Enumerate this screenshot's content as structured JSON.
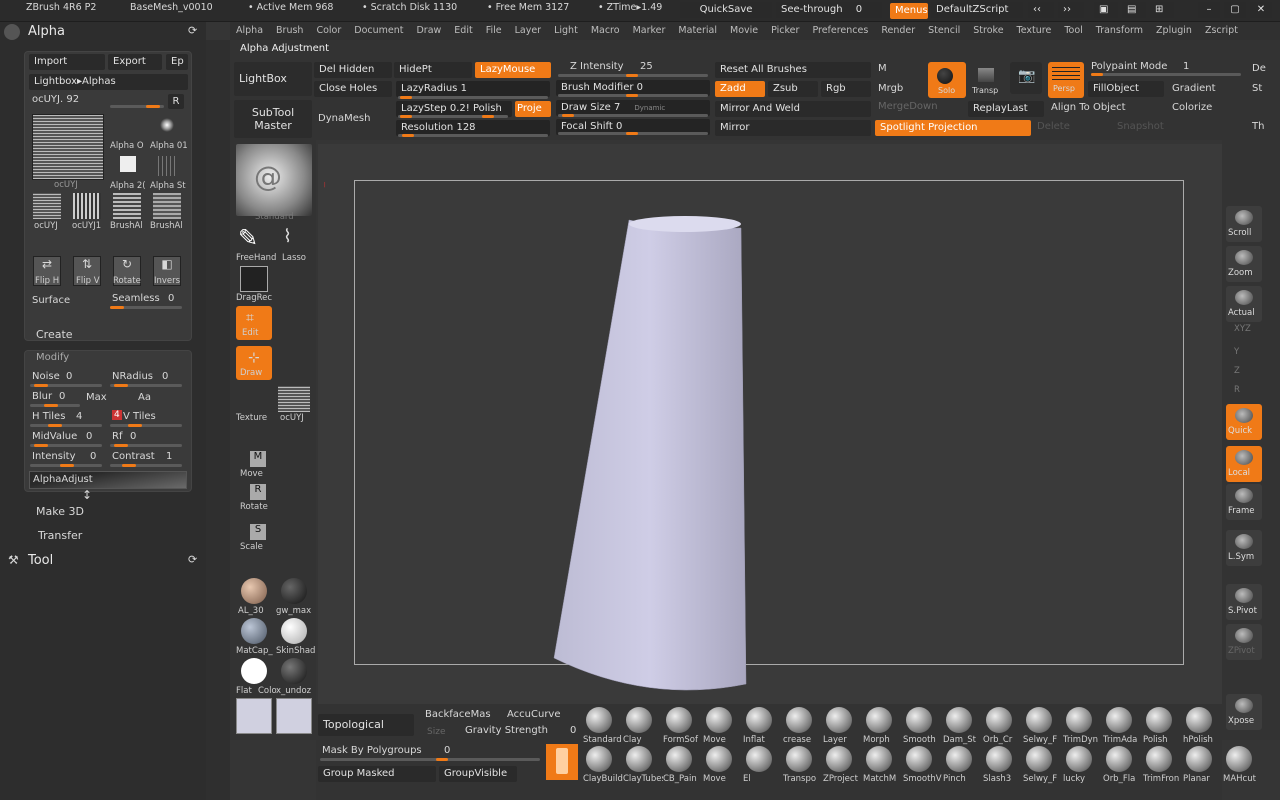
{
  "topbar": {
    "app": "ZBrush 4R6 P2",
    "mesh": "BaseMesh_v0010",
    "active": "• Active Mem 968",
    "scratch": "• Scratch Disk 1130",
    "free": "• Free Mem 3127",
    "ztime": "• ZTime▸1.49",
    "quicksave": "QuickSave",
    "seethrough": "See-through",
    "seethrough_val": "0",
    "menus": "Menus",
    "script": "DefaultZScript"
  },
  "menubar": [
    "Alpha",
    "Brush",
    "Color",
    "Document",
    "Draw",
    "Edit",
    "File",
    "Layer",
    "Light",
    "Macro",
    "Marker",
    "Material",
    "Movie",
    "Picker",
    "Preferences",
    "Render",
    "Stencil",
    "Stroke",
    "Texture",
    "Tool",
    "Transform",
    "Zplugin",
    "Zscript"
  ],
  "alpha_panel": {
    "title": "Alpha",
    "import": "Import",
    "export": "Export",
    "ep": "Ep",
    "lightbox": "Lightbox▸Alphas",
    "current": "ocUYJ. 92",
    "r": "R",
    "thumbs": [
      "Alpha O",
      "Alpha 01",
      "Alpha 2(",
      "Alpha St"
    ],
    "thumbs2": [
      "ocUYJ",
      "ocUYJ1",
      "BrushAl",
      "BrushAl"
    ],
    "flip_h": "Flip H",
    "flip_v": "Flip V",
    "rotate": "Rotate",
    "invers": "Invers",
    "surface": "Surface",
    "seamless": "Seamless",
    "seamless_val": "0",
    "create": "Create",
    "modify": "Modify",
    "noise": "Noise",
    "noise_val": "0",
    "nradius": "NRadius",
    "nradius_val": "0",
    "blur": "Blur",
    "blur_val": "0",
    "max": "Max",
    "aa": "Aa",
    "htiles": "H Tiles",
    "htiles_val": "4",
    "vtiles_num": "4",
    "vtiles": "V Tiles",
    "midvalue": "MidValue",
    "midvalue_val": "0",
    "rf": "Rf",
    "rf_val": "0",
    "intensity": "Intensity",
    "intensity_val": "0",
    "contrast": "Contrast",
    "contrast_val": "1",
    "alphaadjust": "AlphaAdjust",
    "make3d": "Make 3D",
    "transfer": "Transfer",
    "tool": "Tool"
  },
  "header": {
    "alpha_adjustment": "Alpha Adjustment",
    "lightbox": "LightBox",
    "subtool_master": "SubTool Master",
    "dynamesh": "DynaMesh",
    "del_hidden": "Del Hidden",
    "hidept": "HidePt",
    "lazymouse": "LazyMouse",
    "close_holes": "Close Holes",
    "lazyradius": "LazyRadius",
    "lazyradius_val": "1",
    "lazystep": "LazyStep",
    "lazystep_val": "0.2!",
    "polish": "Polish",
    "proje": "Proje",
    "resolution": "Resolution",
    "resolution_val": "128",
    "z_intensity": "Z Intensity",
    "z_intensity_val": "25",
    "brush_modifier": "Brush Modifier",
    "brush_modifier_val": "0",
    "draw_size": "Draw Size",
    "draw_size_val": "7",
    "dynamic": "Dynamic",
    "focal_shift": "Focal Shift",
    "focal_shift_val": "0",
    "reset_all": "Reset All Brushes",
    "zadd": "Zadd",
    "zsub": "Zsub",
    "rgb": "Rgb",
    "mirror_weld": "Mirror And Weld",
    "mirror": "Mirror",
    "m": "M",
    "mrgb": "Mrgb",
    "mergedown": "MergeDown",
    "solo": "Solo",
    "transp": "Transp",
    "persp": "Persp",
    "polypaint": "Polypaint Mode",
    "polypaint_val": "1",
    "fillobject": "FillObject",
    "gradient": "Gradient",
    "replaylast": "ReplayLast",
    "align": "Align To Object",
    "colorize": "Colorize",
    "spotlight": "Spotlight Projection",
    "delete": "Delete",
    "snapshot": "Snapshot",
    "de": "De",
    "st": "St",
    "th": "Th"
  },
  "left_tools": {
    "brush_name": "Standard",
    "freehand": "FreeHand",
    "lasso": "Lasso",
    "dragrect": "DragRec",
    "edit": "Edit",
    "draw": "Draw",
    "texture": "Texture",
    "texture_thumb": "ocUYJ",
    "move": "Move",
    "rotate": "Rotate",
    "scale": "Scale",
    "materials": [
      "AL_30",
      "gw_max",
      "MatCap_",
      "SkinShad",
      "Flat",
      "Colo",
      "x_undoz"
    ]
  },
  "right_tools": [
    "Scroll",
    "Zoom",
    "Actual",
    "XYZ",
    "Y",
    "Z",
    "R",
    "Quick",
    "Local",
    "Frame",
    "L.Sym",
    "S.Pivot",
    "ZPivot",
    "Xpose"
  ],
  "bottom": {
    "topological": "Topological",
    "backface": "BackfaceMas",
    "accucurve": "AccuCurve",
    "size": "Size",
    "gravity": "Gravity Strength",
    "gravity_val": "0",
    "mask_poly": "Mask By Polygroups",
    "mask_poly_val": "0",
    "group_masked": "Group Masked",
    "group_visible": "GroupVisible",
    "brushes_row1": [
      "Standard",
      "Clay",
      "FormSof",
      "Move",
      "Inflat",
      "crease",
      "Layer",
      "Morph",
      "Smooth",
      "Dam_St",
      "Orb_Cr",
      "Selwy_F",
      "TrimDyn",
      "TrimAda",
      "Polish",
      "hPolish"
    ],
    "brushes_row2": [
      "ClayBuild",
      "ClayTubes",
      "CB_Pain",
      "Move",
      "El",
      "Transpo",
      "ZProject",
      "MatchM",
      "SmoothV",
      "Pinch",
      "Slash3",
      "Selwy_F",
      "lucky",
      "Orb_Fla",
      "TrimFron",
      "Planar",
      "MAHcut"
    ]
  },
  "colors": {
    "accent": "#f07a17",
    "bg": "#353535",
    "mesh": "#c8c6de"
  }
}
